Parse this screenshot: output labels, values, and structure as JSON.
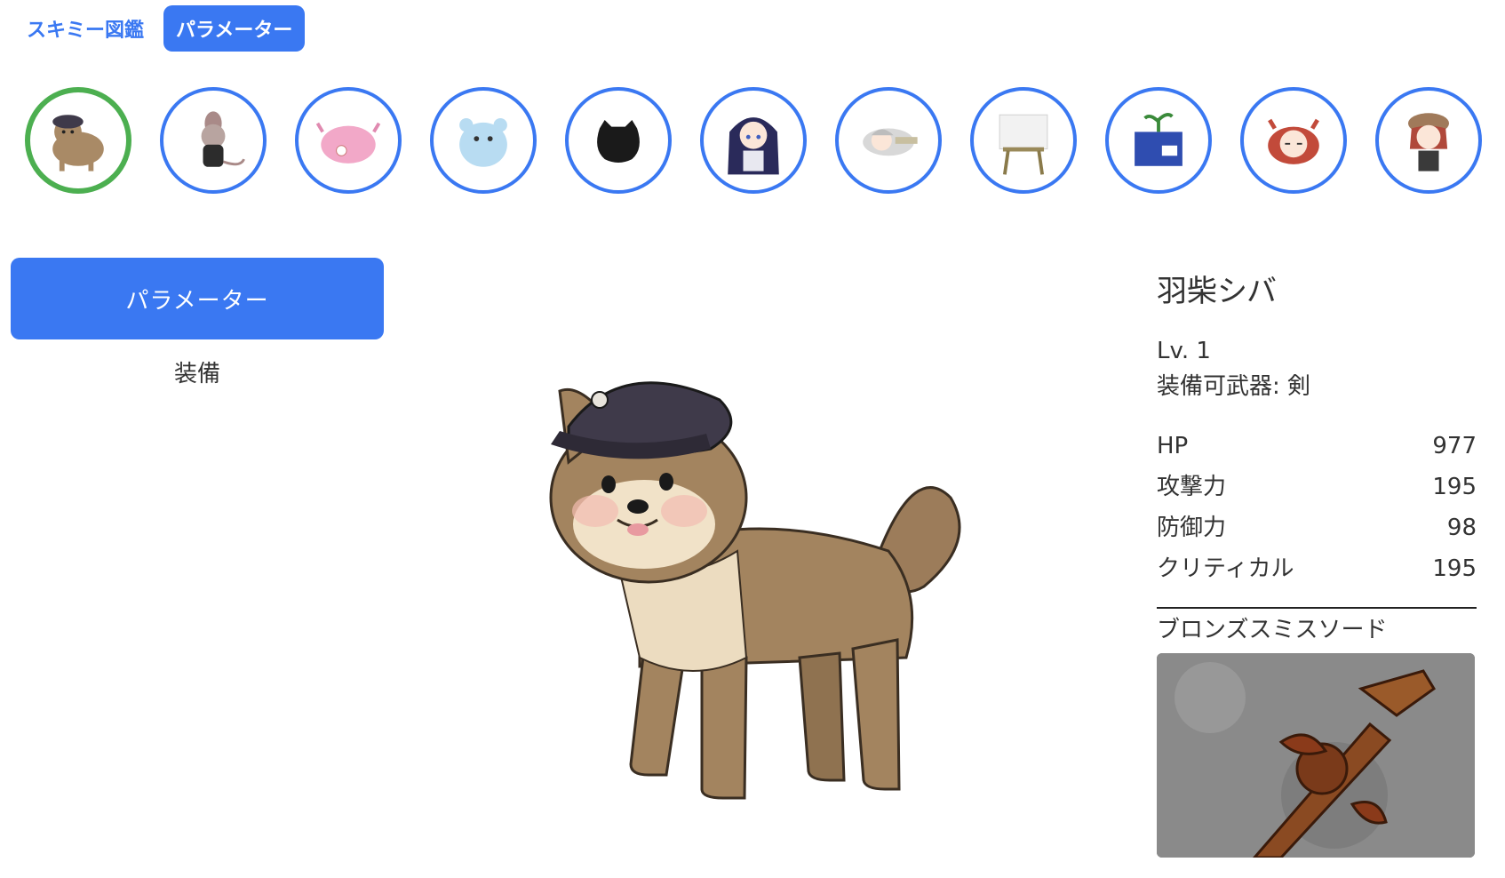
{
  "tabs": [
    {
      "label": "スキミー図鑑",
      "active": false
    },
    {
      "label": "パラメーター",
      "active": true
    }
  ],
  "characters": [
    {
      "icon": "shiba-dog-icon",
      "selected": true
    },
    {
      "icon": "mouse-icon",
      "selected": false
    },
    {
      "icon": "pink-axolotl-icon",
      "selected": false
    },
    {
      "icon": "ice-bear-icon",
      "selected": false
    },
    {
      "icon": "black-blob-icon",
      "selected": false
    },
    {
      "icon": "dark-haired-girl-icon",
      "selected": false
    },
    {
      "icon": "sleeping-girl-icon",
      "selected": false
    },
    {
      "icon": "easel-icon",
      "selected": false
    },
    {
      "icon": "plant-box-icon",
      "selected": false
    },
    {
      "icon": "red-haired-girl-icon",
      "selected": false
    },
    {
      "icon": "cap-girl-icon",
      "selected": false
    }
  ],
  "left_menu": {
    "parameter_label": "パラメーター",
    "equipment_label": "装備"
  },
  "character": {
    "name": "羽柴シバ",
    "level": "Lv. 1",
    "weapon_type": "装備可武器: 剣",
    "stats": [
      {
        "label": "HP",
        "value": "977"
      },
      {
        "label": "攻撃力",
        "value": "195"
      },
      {
        "label": "防御力",
        "value": "98"
      },
      {
        "label": "クリティカル",
        "value": "195"
      }
    ],
    "weapon_name": "ブロンズスミスソード"
  },
  "colors": {
    "accent": "#3a78f2",
    "selected": "#4caf50"
  }
}
